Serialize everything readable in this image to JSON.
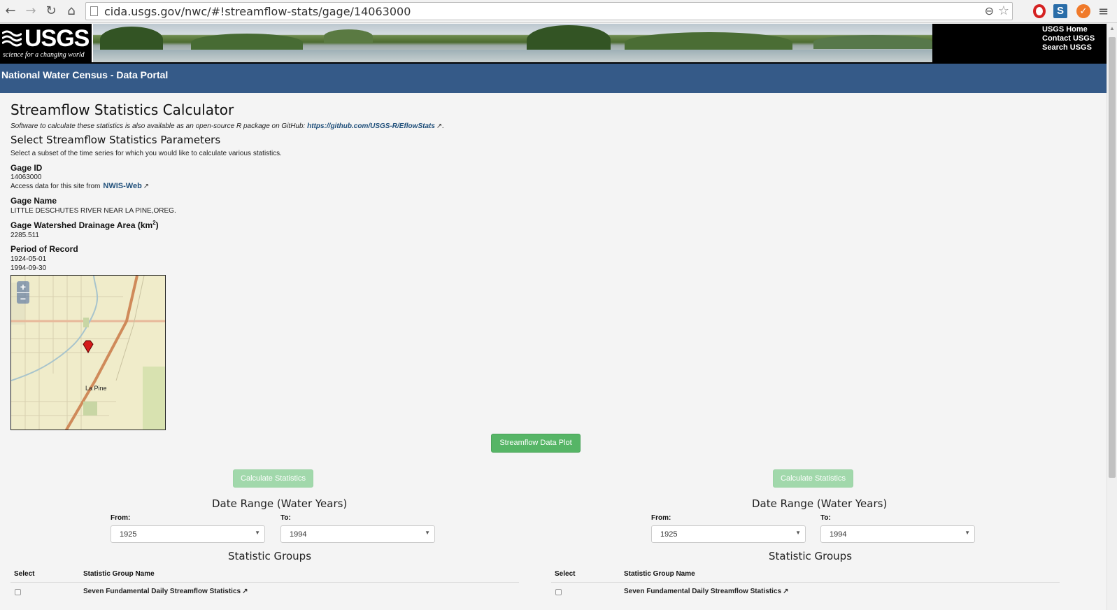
{
  "browser": {
    "url": "cida.usgs.gov/nwc/#!streamflow-stats/gage/14063000",
    "back_icon": "back-arrow-icon",
    "forward_icon": "forward-arrow-icon",
    "reload_icon": "reload-icon",
    "home_icon": "home-icon"
  },
  "banner": {
    "logo": "USGS",
    "tagline": "science for a changing world",
    "links": [
      "USGS Home",
      "Contact USGS",
      "Search USGS"
    ]
  },
  "portal_title": "National Water Census - Data Portal",
  "page": {
    "title": "Streamflow Statistics Calculator",
    "note_prefix": "Software to calculate these statistics is also available as an open-source R package on GitHub: ",
    "note_link": "https://github.com/USGS-R/EflowStats",
    "note_suffix": ".",
    "params_heading": "Select Streamflow Statistics Parameters",
    "params_sub": "Select a subset of the time series for which you would like to calculate various statistics."
  },
  "gage": {
    "id_label": "Gage ID",
    "id": "14063000",
    "access_prefix": "Access data for this site from",
    "access_link": "NWIS-Web",
    "name_label": "Gage Name",
    "name": "LITTLE DESCHUTES RIVER NEAR LA PINE,OREG.",
    "area_label": "Gage Watershed Drainage Area (km",
    "area_sup": "2",
    "area_label_end": ")",
    "area": "2285.511",
    "period_label": "Period of Record",
    "period_start": "1924-05-01",
    "period_end": "1994-09-30"
  },
  "map": {
    "place_label": "La Pine",
    "zoom_in": "+",
    "zoom_out": "−"
  },
  "buttons": {
    "plot": "Streamflow Data Plot",
    "calc": "Calculate Statistics"
  },
  "panels": [
    {
      "date_range_title": "Date Range (Water Years)",
      "from_label": "From:",
      "to_label": "To:",
      "from_value": "1925",
      "to_value": "1994",
      "groups_title": "Statistic Groups",
      "col_select": "Select",
      "col_name": "Statistic Group Name",
      "first_group": "Seven Fundamental Daily Streamflow Statistics"
    },
    {
      "date_range_title": "Date Range (Water Years)",
      "from_label": "From:",
      "to_label": "To:",
      "from_value": "1925",
      "to_value": "1994",
      "groups_title": "Statistic Groups",
      "col_select": "Select",
      "col_name": "Statistic Group Name",
      "first_group": "Seven Fundamental Daily Streamflow Statistics"
    }
  ],
  "colors": {
    "title_bar": "#355a88",
    "button_green": "#56b566",
    "link_blue": "#1f4f7a"
  }
}
